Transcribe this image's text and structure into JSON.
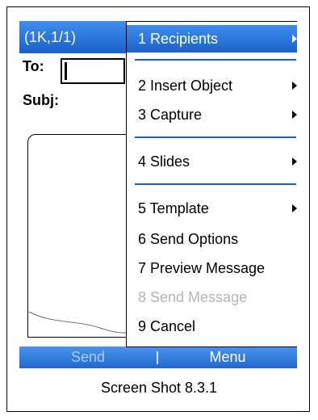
{
  "titlebar": {
    "title": "(1K,1/1)"
  },
  "compose": {
    "to_label": "To:",
    "subj_label": "Subj:"
  },
  "menu": {
    "items": [
      {
        "label": "1 Recipients",
        "submenu": true,
        "selected": true,
        "disabled": false
      },
      {
        "label": "2 Insert Object",
        "submenu": true,
        "selected": false,
        "disabled": false
      },
      {
        "label": "3 Capture",
        "submenu": true,
        "selected": false,
        "disabled": false
      },
      {
        "label": "4 Slides",
        "submenu": true,
        "selected": false,
        "disabled": false
      },
      {
        "label": "5 Template",
        "submenu": true,
        "selected": false,
        "disabled": false
      },
      {
        "label": "6 Send Options",
        "submenu": false,
        "selected": false,
        "disabled": false
      },
      {
        "label": "7 Preview Message",
        "submenu": false,
        "selected": false,
        "disabled": false
      },
      {
        "label": "8 Send Message",
        "submenu": false,
        "selected": false,
        "disabled": true
      },
      {
        "label": "9 Cancel",
        "submenu": false,
        "selected": false,
        "disabled": false
      }
    ]
  },
  "softkeys": {
    "left": "Send",
    "right": "Menu"
  },
  "caption": "Screen Shot 8.3.1",
  "colors": {
    "accent": "#1a62c8",
    "disabled_text": "#b5b5b5"
  }
}
